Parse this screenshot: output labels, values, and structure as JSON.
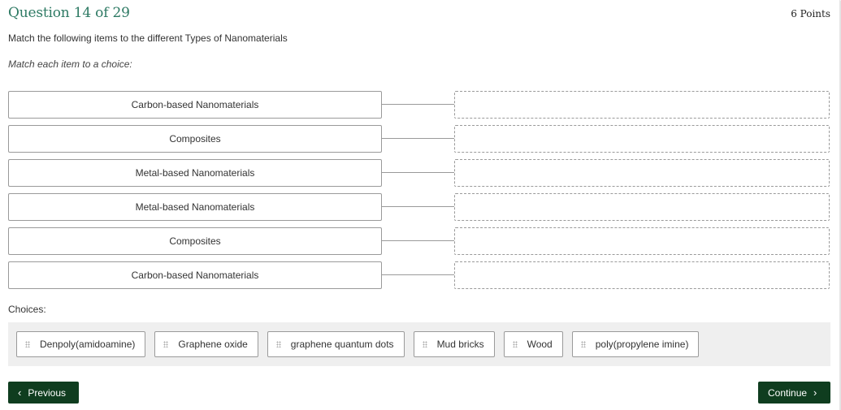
{
  "header": {
    "question_label": "Question 14 of 29",
    "points": "6 Points"
  },
  "question": {
    "prompt": "Match the following items to the different Types of Nanomaterials",
    "instruction": "Match each item to a choice:"
  },
  "match_rows": [
    {
      "item": "Carbon-based Nanomaterials",
      "answer": ""
    },
    {
      "item": "Composites",
      "answer": ""
    },
    {
      "item": "Metal-based Nanomaterials",
      "answer": ""
    },
    {
      "item": "Metal-based Nanomaterials",
      "answer": ""
    },
    {
      "item": "Composites",
      "answer": ""
    },
    {
      "item": "Carbon-based Nanomaterials",
      "answer": ""
    }
  ],
  "choices": {
    "label": "Choices:",
    "items": [
      "Denpoly(amidoamine)",
      "Graphene oxide",
      "graphene quantum dots",
      "Mud bricks",
      "Wood",
      "poly(propylene imine)"
    ],
    "icon": "drag-grip-icon"
  },
  "navigation": {
    "previous_label": "Previous",
    "continue_label": "Continue",
    "previous_icon": "‹",
    "continue_icon": "›"
  },
  "colors": {
    "title": "#2e7a64",
    "button_bg": "#0f3d1f",
    "bank_bg": "#efefef"
  }
}
